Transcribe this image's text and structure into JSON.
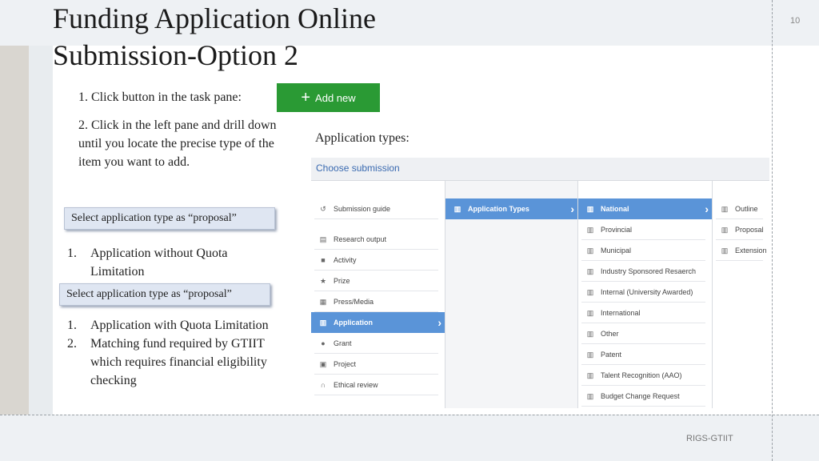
{
  "slide": {
    "title_line1": "Funding Application Online",
    "title_line2": "Submission-Option 2",
    "page_number": "10",
    "footer": "RIGS-GTIIT"
  },
  "steps": {
    "step1": "1. Click button in the task pane:",
    "step2": "2. Click in the left pane and drill down until you locate the precise type of the item you want to add.",
    "add_new_label": "Add new",
    "app_types_label": "Application types:"
  },
  "callouts": {
    "first": "Select application type as “proposal”",
    "second": "Select application type as “proposal”"
  },
  "list_without_quota": [
    {
      "num": "1.",
      "text": "Application without Quota Limitation"
    }
  ],
  "list_with_quota": [
    {
      "num": "1.",
      "text": "Application with Quota Limitation"
    },
    {
      "num": "2.",
      "text": "Matching fund required by GTIIT which requires financial eligibility checking"
    }
  ],
  "screenshot": {
    "header": "Choose submission",
    "col1": [
      {
        "icon": "history-icon",
        "glyph": "↺",
        "label": "Submission guide"
      },
      {
        "icon": "book-icon",
        "glyph": "▤",
        "label": "Research output"
      },
      {
        "icon": "briefcase-icon",
        "glyph": "■",
        "label": "Activity"
      },
      {
        "icon": "trophy-icon",
        "glyph": "★",
        "label": "Prize"
      },
      {
        "icon": "newspaper-icon",
        "glyph": "▦",
        "label": "Press/Media"
      },
      {
        "icon": "bars-icon",
        "glyph": "▥",
        "label": "Application",
        "active": true
      },
      {
        "icon": "moneybag-icon",
        "glyph": "●",
        "label": "Grant"
      },
      {
        "icon": "cube-icon",
        "glyph": "▣",
        "label": "Project"
      },
      {
        "icon": "headphones-icon",
        "glyph": "∩",
        "label": "Ethical review"
      }
    ],
    "col2": [
      {
        "icon": "bars-icon",
        "glyph": "▥",
        "label": "Application Types",
        "active": true
      }
    ],
    "col3": [
      {
        "icon": "bars-icon",
        "glyph": "▥",
        "label": "National",
        "active": true
      },
      {
        "icon": "bars-icon",
        "glyph": "▥",
        "label": "Provincial"
      },
      {
        "icon": "bars-icon",
        "glyph": "▥",
        "label": "Municipal"
      },
      {
        "icon": "bars-icon",
        "glyph": "▥",
        "label": "Industry Sponsored Resaerch"
      },
      {
        "icon": "bars-icon",
        "glyph": "▥",
        "label": "Internal (University Awarded)"
      },
      {
        "icon": "bars-icon",
        "glyph": "▥",
        "label": "International"
      },
      {
        "icon": "bars-icon",
        "glyph": "▥",
        "label": "Other"
      },
      {
        "icon": "bars-icon",
        "glyph": "▥",
        "label": "Patent"
      },
      {
        "icon": "bars-icon",
        "glyph": "▥",
        "label": "Talent Recognition (AAO)"
      },
      {
        "icon": "bars-icon",
        "glyph": "▥",
        "label": "Budget Change Request"
      }
    ],
    "col4": [
      {
        "icon": "bars-icon",
        "glyph": "▥",
        "label": "Outline"
      },
      {
        "icon": "bars-icon",
        "glyph": "▥",
        "label": "Proposal"
      },
      {
        "icon": "bars-icon",
        "glyph": "▥",
        "label": "Extension"
      }
    ]
  },
  "colors": {
    "add_button": "#2a9a34",
    "active_row": "#5a94d8",
    "callout_bg": "#dfe6f2"
  }
}
